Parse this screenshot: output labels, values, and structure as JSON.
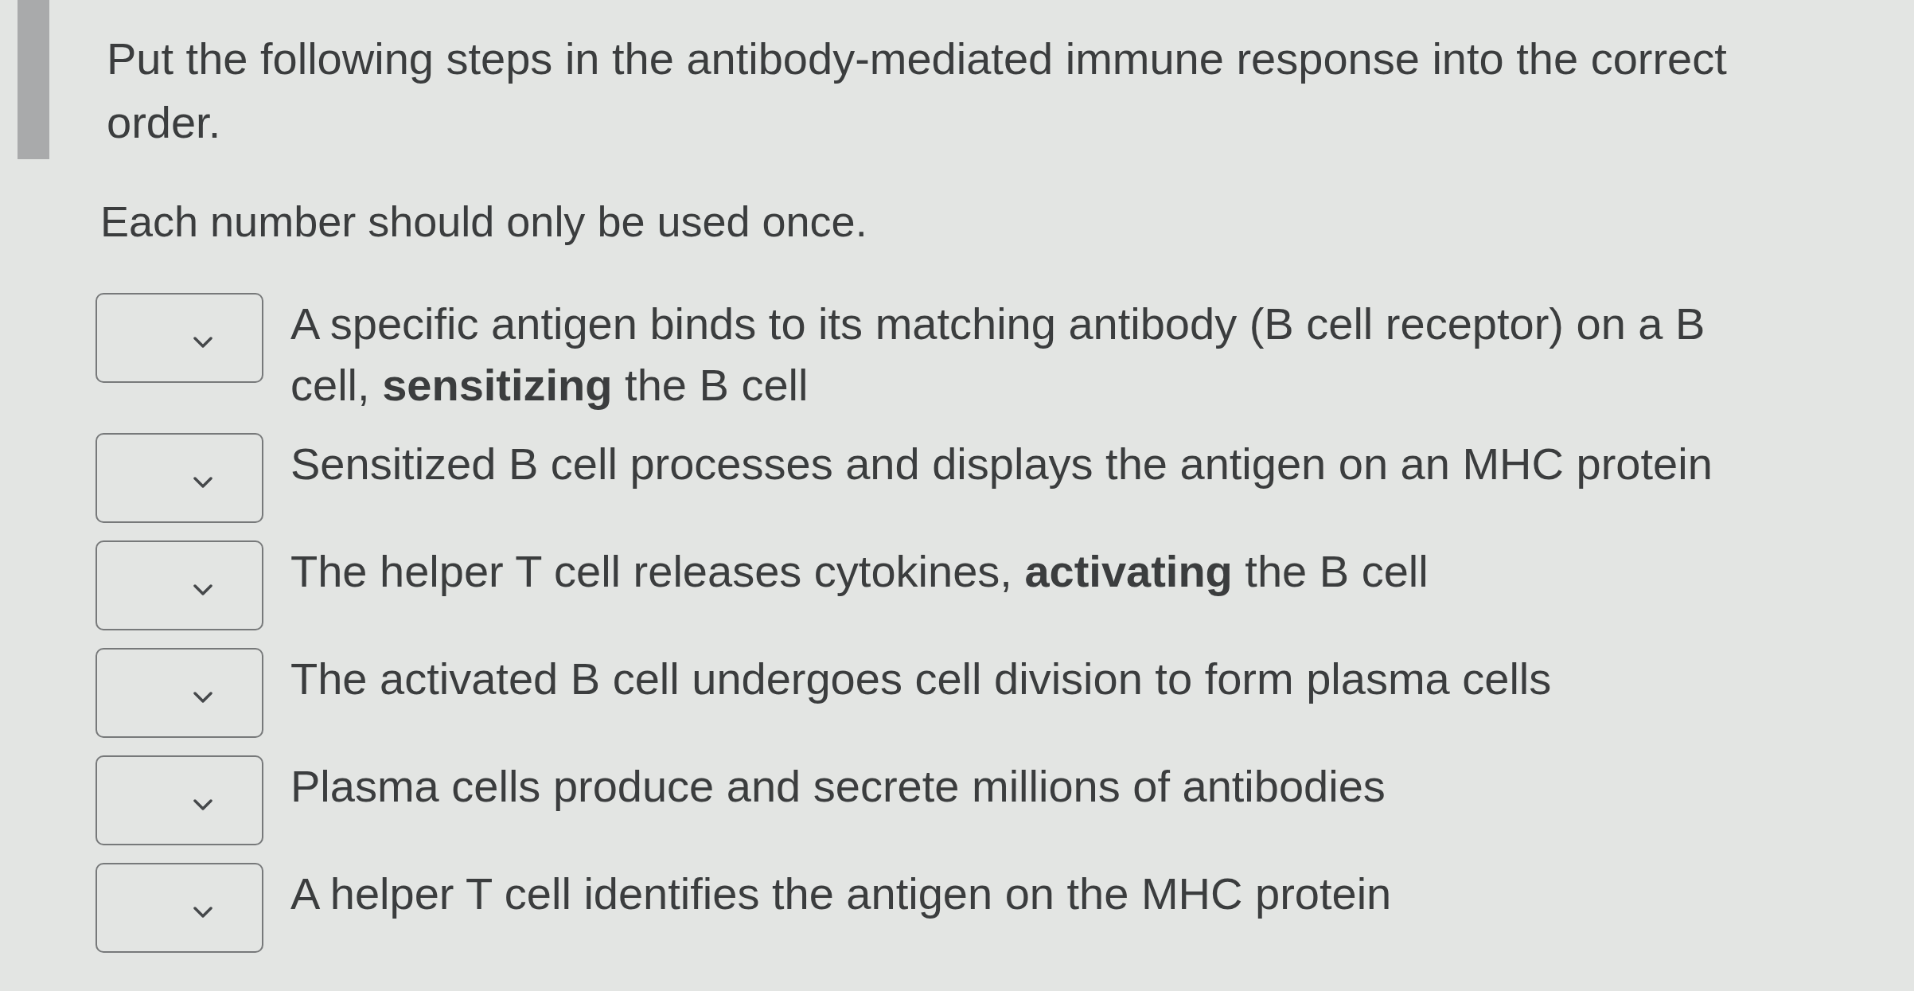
{
  "question": {
    "prompt": "Put the following steps in the antibody-mediated immune response into the correct order.",
    "instruction": "Each number should only be used once."
  },
  "steps": [
    {
      "text": "A specific antigen binds to its matching antibody (B cell receptor) on a B cell, **sensitizing** the B cell"
    },
    {
      "text": "Sensitized B cell processes and displays the antigen on an MHC protein"
    },
    {
      "text": "The helper T cell releases cytokines, **activating** the B cell"
    },
    {
      "text": "The activated B cell undergoes cell division to form plasma cells"
    },
    {
      "text": "Plasma cells produce and secrete millions of antibodies"
    },
    {
      "text": "A helper T cell identifies the antigen on the MHC protein"
    }
  ]
}
